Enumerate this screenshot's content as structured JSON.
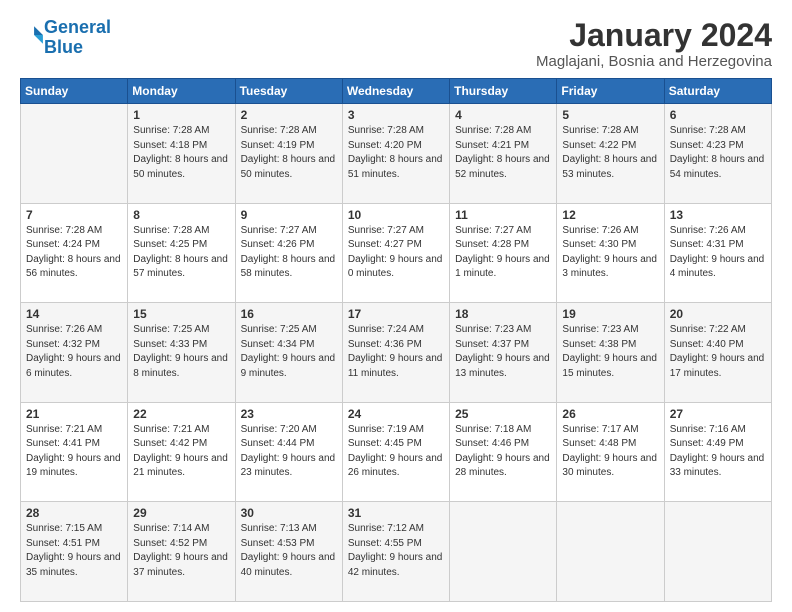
{
  "header": {
    "logo_line1": "General",
    "logo_line2": "Blue",
    "month_year": "January 2024",
    "location": "Maglajani, Bosnia and Herzegovina"
  },
  "weekdays": [
    "Sunday",
    "Monday",
    "Tuesday",
    "Wednesday",
    "Thursday",
    "Friday",
    "Saturday"
  ],
  "weeks": [
    [
      {
        "day": "",
        "sunrise": "",
        "sunset": "",
        "daylight": ""
      },
      {
        "day": "1",
        "sunrise": "Sunrise: 7:28 AM",
        "sunset": "Sunset: 4:18 PM",
        "daylight": "Daylight: 8 hours and 50 minutes."
      },
      {
        "day": "2",
        "sunrise": "Sunrise: 7:28 AM",
        "sunset": "Sunset: 4:19 PM",
        "daylight": "Daylight: 8 hours and 50 minutes."
      },
      {
        "day": "3",
        "sunrise": "Sunrise: 7:28 AM",
        "sunset": "Sunset: 4:20 PM",
        "daylight": "Daylight: 8 hours and 51 minutes."
      },
      {
        "day": "4",
        "sunrise": "Sunrise: 7:28 AM",
        "sunset": "Sunset: 4:21 PM",
        "daylight": "Daylight: 8 hours and 52 minutes."
      },
      {
        "day": "5",
        "sunrise": "Sunrise: 7:28 AM",
        "sunset": "Sunset: 4:22 PM",
        "daylight": "Daylight: 8 hours and 53 minutes."
      },
      {
        "day": "6",
        "sunrise": "Sunrise: 7:28 AM",
        "sunset": "Sunset: 4:23 PM",
        "daylight": "Daylight: 8 hours and 54 minutes."
      }
    ],
    [
      {
        "day": "7",
        "sunrise": "Sunrise: 7:28 AM",
        "sunset": "Sunset: 4:24 PM",
        "daylight": "Daylight: 8 hours and 56 minutes."
      },
      {
        "day": "8",
        "sunrise": "Sunrise: 7:28 AM",
        "sunset": "Sunset: 4:25 PM",
        "daylight": "Daylight: 8 hours and 57 minutes."
      },
      {
        "day": "9",
        "sunrise": "Sunrise: 7:27 AM",
        "sunset": "Sunset: 4:26 PM",
        "daylight": "Daylight: 8 hours and 58 minutes."
      },
      {
        "day": "10",
        "sunrise": "Sunrise: 7:27 AM",
        "sunset": "Sunset: 4:27 PM",
        "daylight": "Daylight: 9 hours and 0 minutes."
      },
      {
        "day": "11",
        "sunrise": "Sunrise: 7:27 AM",
        "sunset": "Sunset: 4:28 PM",
        "daylight": "Daylight: 9 hours and 1 minute."
      },
      {
        "day": "12",
        "sunrise": "Sunrise: 7:26 AM",
        "sunset": "Sunset: 4:30 PM",
        "daylight": "Daylight: 9 hours and 3 minutes."
      },
      {
        "day": "13",
        "sunrise": "Sunrise: 7:26 AM",
        "sunset": "Sunset: 4:31 PM",
        "daylight": "Daylight: 9 hours and 4 minutes."
      }
    ],
    [
      {
        "day": "14",
        "sunrise": "Sunrise: 7:26 AM",
        "sunset": "Sunset: 4:32 PM",
        "daylight": "Daylight: 9 hours and 6 minutes."
      },
      {
        "day": "15",
        "sunrise": "Sunrise: 7:25 AM",
        "sunset": "Sunset: 4:33 PM",
        "daylight": "Daylight: 9 hours and 8 minutes."
      },
      {
        "day": "16",
        "sunrise": "Sunrise: 7:25 AM",
        "sunset": "Sunset: 4:34 PM",
        "daylight": "Daylight: 9 hours and 9 minutes."
      },
      {
        "day": "17",
        "sunrise": "Sunrise: 7:24 AM",
        "sunset": "Sunset: 4:36 PM",
        "daylight": "Daylight: 9 hours and 11 minutes."
      },
      {
        "day": "18",
        "sunrise": "Sunrise: 7:23 AM",
        "sunset": "Sunset: 4:37 PM",
        "daylight": "Daylight: 9 hours and 13 minutes."
      },
      {
        "day": "19",
        "sunrise": "Sunrise: 7:23 AM",
        "sunset": "Sunset: 4:38 PM",
        "daylight": "Daylight: 9 hours and 15 minutes."
      },
      {
        "day": "20",
        "sunrise": "Sunrise: 7:22 AM",
        "sunset": "Sunset: 4:40 PM",
        "daylight": "Daylight: 9 hours and 17 minutes."
      }
    ],
    [
      {
        "day": "21",
        "sunrise": "Sunrise: 7:21 AM",
        "sunset": "Sunset: 4:41 PM",
        "daylight": "Daylight: 9 hours and 19 minutes."
      },
      {
        "day": "22",
        "sunrise": "Sunrise: 7:21 AM",
        "sunset": "Sunset: 4:42 PM",
        "daylight": "Daylight: 9 hours and 21 minutes."
      },
      {
        "day": "23",
        "sunrise": "Sunrise: 7:20 AM",
        "sunset": "Sunset: 4:44 PM",
        "daylight": "Daylight: 9 hours and 23 minutes."
      },
      {
        "day": "24",
        "sunrise": "Sunrise: 7:19 AM",
        "sunset": "Sunset: 4:45 PM",
        "daylight": "Daylight: 9 hours and 26 minutes."
      },
      {
        "day": "25",
        "sunrise": "Sunrise: 7:18 AM",
        "sunset": "Sunset: 4:46 PM",
        "daylight": "Daylight: 9 hours and 28 minutes."
      },
      {
        "day": "26",
        "sunrise": "Sunrise: 7:17 AM",
        "sunset": "Sunset: 4:48 PM",
        "daylight": "Daylight: 9 hours and 30 minutes."
      },
      {
        "day": "27",
        "sunrise": "Sunrise: 7:16 AM",
        "sunset": "Sunset: 4:49 PM",
        "daylight": "Daylight: 9 hours and 33 minutes."
      }
    ],
    [
      {
        "day": "28",
        "sunrise": "Sunrise: 7:15 AM",
        "sunset": "Sunset: 4:51 PM",
        "daylight": "Daylight: 9 hours and 35 minutes."
      },
      {
        "day": "29",
        "sunrise": "Sunrise: 7:14 AM",
        "sunset": "Sunset: 4:52 PM",
        "daylight": "Daylight: 9 hours and 37 minutes."
      },
      {
        "day": "30",
        "sunrise": "Sunrise: 7:13 AM",
        "sunset": "Sunset: 4:53 PM",
        "daylight": "Daylight: 9 hours and 40 minutes."
      },
      {
        "day": "31",
        "sunrise": "Sunrise: 7:12 AM",
        "sunset": "Sunset: 4:55 PM",
        "daylight": "Daylight: 9 hours and 42 minutes."
      },
      {
        "day": "",
        "sunrise": "",
        "sunset": "",
        "daylight": ""
      },
      {
        "day": "",
        "sunrise": "",
        "sunset": "",
        "daylight": ""
      },
      {
        "day": "",
        "sunrise": "",
        "sunset": "",
        "daylight": ""
      }
    ]
  ]
}
